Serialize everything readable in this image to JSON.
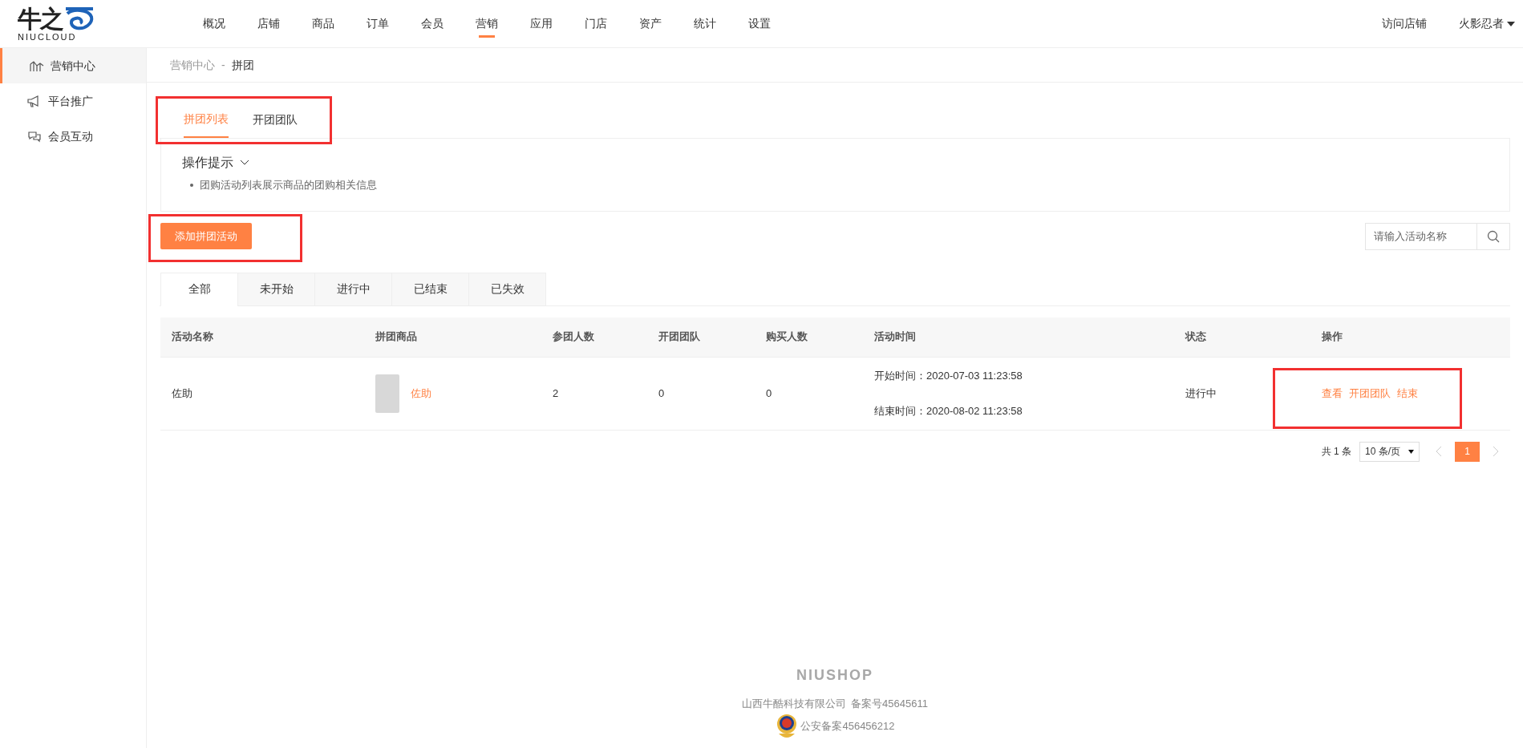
{
  "logo": {
    "mark": "牛之",
    "word": "NIUCLOUD"
  },
  "nav": [
    {
      "label": "概况",
      "selected": false
    },
    {
      "label": "店铺",
      "selected": false
    },
    {
      "label": "商品",
      "selected": false
    },
    {
      "label": "订单",
      "selected": false
    },
    {
      "label": "会员",
      "selected": false
    },
    {
      "label": "营销",
      "selected": true
    },
    {
      "label": "应用",
      "selected": false
    },
    {
      "label": "门店",
      "selected": false
    },
    {
      "label": "资产",
      "selected": false
    },
    {
      "label": "统计",
      "selected": false
    },
    {
      "label": "设置",
      "selected": false
    }
  ],
  "header_right": {
    "visit": "访问店铺",
    "user": "火影忍者"
  },
  "sidebar": [
    {
      "label": "营销中心",
      "kind": "chart",
      "selected": true
    },
    {
      "label": "平台推广",
      "kind": "megaphone",
      "selected": false
    },
    {
      "label": "会员互动",
      "kind": "chat",
      "selected": false
    }
  ],
  "breadcrumb": {
    "parent": "营销中心",
    "separator": "-",
    "current": "拼团"
  },
  "page_tabs": [
    {
      "label": "拼团列表",
      "selected": true
    },
    {
      "label": "开团团队",
      "selected": false
    }
  ],
  "tips": {
    "title": "操作提示",
    "items": [
      "团购活动列表展示商品的团购相关信息"
    ]
  },
  "add_button": "添加拼团活动",
  "search": {
    "placeholder": "请输入活动名称"
  },
  "status_tabs": [
    {
      "label": "全部",
      "selected": true
    },
    {
      "label": "未开始",
      "selected": false
    },
    {
      "label": "进行中",
      "selected": false
    },
    {
      "label": "已结束",
      "selected": false
    },
    {
      "label": "已失效",
      "selected": false
    }
  ],
  "table": {
    "columns": [
      "活动名称",
      "拼团商品",
      "参团人数",
      "开团团队",
      "购买人数",
      "活动时间",
      "状态",
      "操作"
    ],
    "rows": [
      {
        "name": "佐助",
        "product": "佐助",
        "joined": "2",
        "teams": "0",
        "buyers": "0",
        "start": "开始时间：2020-07-03 11:23:58",
        "end": "结束时间：2020-08-02 11:23:58",
        "status": "进行中",
        "actions": [
          "查看",
          "开团团队",
          "结束"
        ]
      }
    ]
  },
  "pagination": {
    "total": "共 1 条",
    "page_size": "10 条/页",
    "pages": [
      {
        "label": "1",
        "selected": true
      }
    ]
  },
  "footer": {
    "brand": "NIUSHOP",
    "company": "山西牛酷科技有限公司",
    "icp": "备案号45645611",
    "police": "公安备案456456212"
  }
}
